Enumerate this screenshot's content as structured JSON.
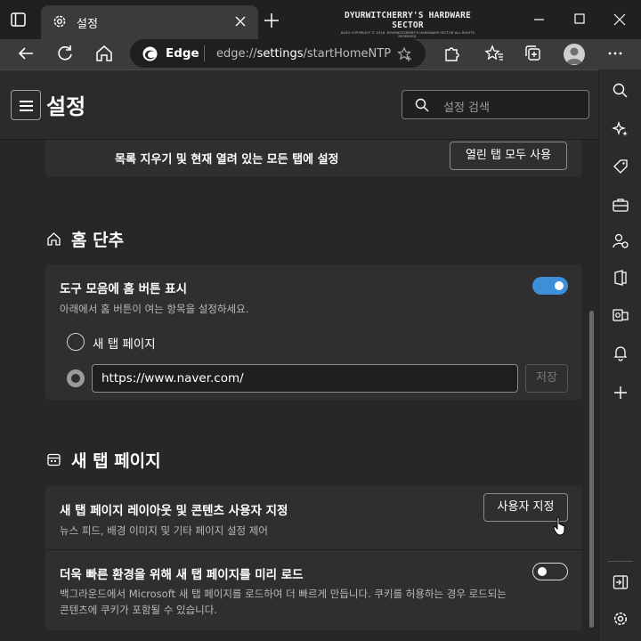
{
  "window": {
    "tab_title": "설정",
    "watermark_title": "DYURWITCHERRY'S HARDWARE SECTOR",
    "watermark_sub": "BLOG COPYRIGHT © 2018. DYURWITCHERRY'S HARDWARE SECTOR ALL RIGHTS RESERVED."
  },
  "address_bar": {
    "site_label": "Edge",
    "url_prefix": "edge://",
    "url_bold": "settings",
    "url_suffix": "/startHomeNTP"
  },
  "settings": {
    "title": "설정",
    "search_placeholder": "설정 검색"
  },
  "startup_card": {
    "text": "목록 지우기 및 현재 열려 있는 모든 탭에 설정",
    "button": "열린 탭 모두 사용"
  },
  "home_section": {
    "title": "홈 단추",
    "show_home_title": "도구 모음에 홈 버튼 표시",
    "show_home_desc": "아래에서 홈 버튼이 여는 항목을 설정하세요.",
    "show_home_enabled": true,
    "option_newtab": "새 탭 페이지",
    "url_value": "https://www.naver.com/",
    "save_button": "저장",
    "selected_option": "url"
  },
  "ntp_section": {
    "title": "새 탭 페이지",
    "customize_title": "새 탭 페이지 레이아웃 및 콘텐츠 사용자 지정",
    "customize_desc": "뉴스 피드, 배경 이미지 및 기타 페이지 설정 제어",
    "customize_button": "사용자 지정",
    "preload_title": "더욱 빠른 환경을 위해 새 탭 페이지를 미리 로드",
    "preload_desc_1": "백그라운드에서 Microsoft 새 탭 페이지를 로드하여 더 빠르게 만듭니다. 쿠키를 허용하는 경우 로드되는",
    "preload_desc_2": "콘텐츠에 쿠키가 포함될 수 있습니다.",
    "preload_enabled": false
  },
  "colors": {
    "accent": "#3d8fd9",
    "background": "#272727",
    "card": "#2f2f2f"
  }
}
